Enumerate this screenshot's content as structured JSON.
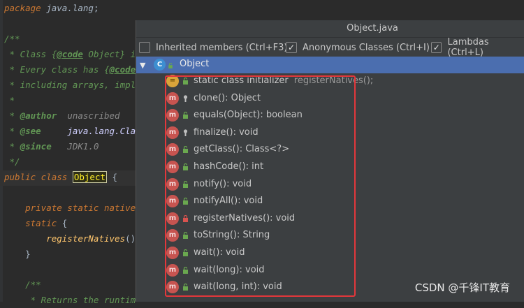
{
  "editor": {
    "lines": [
      {
        "segments": [
          [
            "kw",
            "package "
          ],
          [
            "pkg",
            "java.lang"
          ],
          [
            "plain",
            ";"
          ]
        ]
      },
      {
        "segments": []
      },
      {
        "segments": [
          [
            "com",
            "/**"
          ]
        ]
      },
      {
        "segments": [
          [
            "com",
            " * Class "
          ],
          [
            "com",
            "{"
          ],
          [
            "tag",
            "@code"
          ],
          [
            "com",
            " Object} i"
          ]
        ]
      },
      {
        "segments": [
          [
            "com",
            " * Every class has "
          ],
          [
            "com",
            "{"
          ],
          [
            "tag",
            "@code"
          ]
        ]
      },
      {
        "segments": [
          [
            "com",
            " * including arrays, impl"
          ]
        ]
      },
      {
        "segments": [
          [
            "com",
            " *"
          ]
        ]
      },
      {
        "segments": [
          [
            "com",
            " * "
          ],
          [
            "tag2",
            "@author"
          ],
          [
            "tagv",
            "  unascribed"
          ]
        ]
      },
      {
        "segments": [
          [
            "com",
            " * "
          ],
          [
            "tag2",
            "@see"
          ],
          [
            "ref",
            "     java.lang.Cla"
          ]
        ]
      },
      {
        "segments": [
          [
            "com",
            " * "
          ],
          [
            "tag2",
            "@since"
          ],
          [
            "tagv",
            "   JDK1.0"
          ]
        ]
      },
      {
        "segments": [
          [
            "com",
            " */"
          ]
        ]
      },
      {
        "segments": [
          [
            "kw",
            "public class "
          ],
          [
            "hl",
            "Object"
          ],
          [
            "plain",
            " {"
          ]
        ]
      },
      {
        "segments": []
      },
      {
        "segments": [
          [
            "kw",
            "    private static native"
          ]
        ]
      },
      {
        "segments": [
          [
            "kw",
            "    static "
          ],
          [
            "plain",
            "{"
          ]
        ]
      },
      {
        "segments": [
          [
            "fn",
            "        registerNatives"
          ],
          [
            "plain",
            "()"
          ]
        ]
      },
      {
        "segments": [
          [
            "plain",
            "    }"
          ]
        ]
      },
      {
        "segments": []
      },
      {
        "segments": [
          [
            "com",
            "    /**"
          ]
        ]
      },
      {
        "segments": [
          [
            "com",
            "     * Returns the runtim"
          ]
        ]
      }
    ]
  },
  "popup": {
    "title": "Object.java",
    "options": [
      {
        "label": "Inherited members (Ctrl+F3)",
        "checked": false
      },
      {
        "label": "Anonymous Classes (Ctrl+I)",
        "checked": true
      },
      {
        "label": "Lambdas (Ctrl+L)",
        "checked": true
      }
    ],
    "root": {
      "label": "Object",
      "icon": "C"
    },
    "members": [
      {
        "icon": "static",
        "visibility": "public",
        "label": "static class initializer",
        "extra": "registerNatives();"
      },
      {
        "icon": "m",
        "visibility": "protected",
        "label": "clone(): Object",
        "extra": ""
      },
      {
        "icon": "m",
        "visibility": "public",
        "label": "equals(Object): boolean",
        "extra": ""
      },
      {
        "icon": "m",
        "visibility": "protected",
        "label": "finalize(): void",
        "extra": ""
      },
      {
        "icon": "m",
        "visibility": "public",
        "label": "getClass(): Class<?>",
        "extra": ""
      },
      {
        "icon": "m",
        "visibility": "public",
        "label": "hashCode(): int",
        "extra": ""
      },
      {
        "icon": "m",
        "visibility": "public",
        "label": "notify(): void",
        "extra": ""
      },
      {
        "icon": "m",
        "visibility": "public",
        "label": "notifyAll(): void",
        "extra": ""
      },
      {
        "icon": "m",
        "visibility": "private",
        "label": "registerNatives(): void",
        "extra": ""
      },
      {
        "icon": "m",
        "visibility": "public",
        "label": "toString(): String",
        "extra": ""
      },
      {
        "icon": "m",
        "visibility": "public",
        "label": "wait(): void",
        "extra": ""
      },
      {
        "icon": "m",
        "visibility": "public",
        "label": "wait(long): void",
        "extra": ""
      },
      {
        "icon": "m",
        "visibility": "public",
        "label": "wait(long, int): void",
        "extra": ""
      }
    ]
  },
  "watermark": "CSDN @千锋IT教育",
  "colors": {
    "public": "#6aa84f",
    "protected": "#bdbdbd",
    "private": "#d9534f",
    "selection": "#4b6eaf"
  }
}
